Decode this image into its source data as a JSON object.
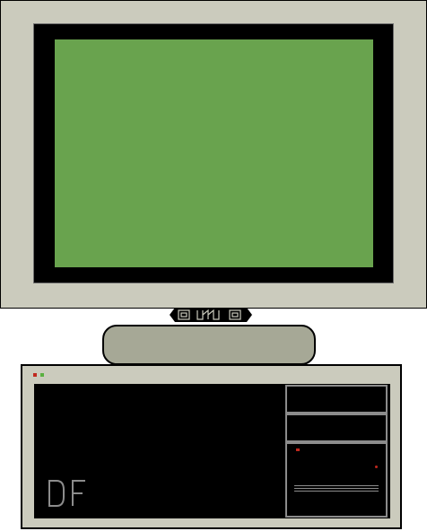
{
  "logo_text": "DF",
  "colors": {
    "screen": "#69a34e",
    "chassis": "#cbcbbd",
    "stand_base": "#a6a896",
    "panel": "#000000",
    "led_red": "#c0281e",
    "led_green": "#59b040"
  }
}
